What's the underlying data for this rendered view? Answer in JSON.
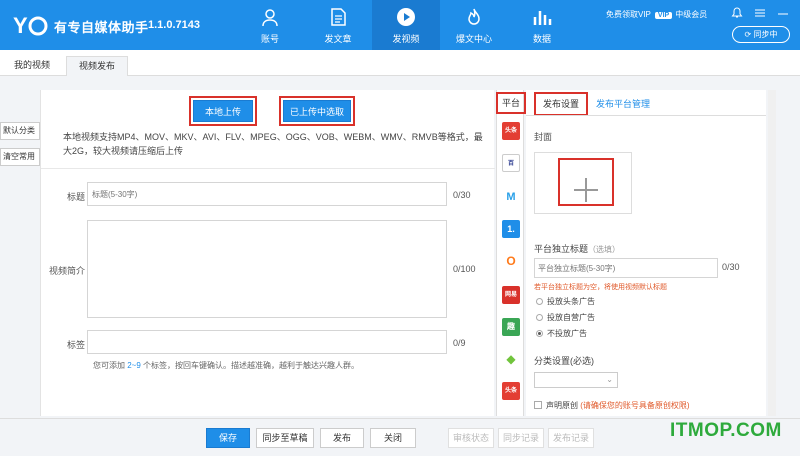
{
  "app": {
    "title": "有专自媒体助手",
    "version": "1.1.0.7143",
    "logo_text": "YC"
  },
  "nav": [
    {
      "label": "账号",
      "icon": "user-icon"
    },
    {
      "label": "发文章",
      "icon": "document-icon"
    },
    {
      "label": "发视频",
      "icon": "play-icon",
      "active": true
    },
    {
      "label": "爆文中心",
      "icon": "flame-icon"
    },
    {
      "label": "数据",
      "icon": "bar-chart-icon"
    }
  ],
  "header": {
    "vip_text": "免费领取VIP",
    "vip_badge": "VIP",
    "member_level": "中级会员",
    "sync_label": "同步中"
  },
  "tabs": {
    "my_videos": "我的视频",
    "video_publish": "视频发布"
  },
  "side": {
    "default_category": "默认分类",
    "clear_common": "清空常用"
  },
  "upload": {
    "local_upload": "本地上传",
    "choose_uploaded": "已上传中选取",
    "description": "本地视频支持MP4、MOV、MKV、AVI、FLV、MPEG、OGG、VOB、WEBM、WMV、RMVB等格式，最大2G，较大视频请压缩后上传"
  },
  "form": {
    "title_label": "标题",
    "title_placeholder": "标题(5-30字)",
    "title_count": "0/30",
    "intro_label": "视频简介",
    "intro_count": "0/100",
    "tags_label": "标签",
    "tags_count": "0/9",
    "tags_hint_prefix": "您可添加 ",
    "tags_hint_range": "2~9",
    "tags_hint_suffix": " 个标签，按回车键确认。描述越准确，越利于触达兴趣人群。"
  },
  "platforms": {
    "header": "平台",
    "items": [
      {
        "name": "toutiao-icon",
        "text": "头条",
        "color": "#e33e33"
      },
      {
        "name": "baijia-icon",
        "text": "百",
        "color": "#2b3b8f"
      },
      {
        "name": "dayu-icon",
        "text": "M",
        "color": "#ffffff"
      },
      {
        "name": "yidian-icon",
        "text": "1.",
        "color": "#1f8ee8"
      },
      {
        "name": "sohu-icon",
        "text": "O",
        "color": "#ff7a1a"
      },
      {
        "name": "wangyi-icon",
        "text": "网易",
        "color": "#d9312a"
      },
      {
        "name": "qutoutiao-icon",
        "text": "趣",
        "color": "#3aa655"
      },
      {
        "name": "aiqiyi-icon",
        "text": "◆",
        "color": "#71c43c"
      },
      {
        "name": "toutiao2-icon",
        "text": "头条",
        "color": "#e33e33"
      }
    ]
  },
  "settings": {
    "tab_settings": "发布设置",
    "tab_manage": "发布平台管理",
    "cover_label": "封面",
    "platform_title_label": "平台独立标题",
    "platform_title_optional": "（选填）",
    "platform_title_placeholder": "平台独立标题(5-30字)",
    "platform_title_count": "0/30",
    "platform_title_warn": "若平台独立标题为空，将使用视频默认标题",
    "ad_options": [
      "投放头条广告",
      "投放自营广告",
      "不投放广告"
    ],
    "ad_selected": 2,
    "category_label": "分类设置(必选)",
    "original_label": "声明原创",
    "original_warn": "(请确保您的账号具备原创权限)"
  },
  "bottom": {
    "save": "保存",
    "sync_draft": "同步至草稿",
    "publish": "发布",
    "close": "关闭",
    "review_status": "审核状态",
    "sync_record": "同步记录",
    "publish_record": "发布记录"
  },
  "watermark": "ITMOP.COM",
  "colors": {
    "brand": "#1f8ee8",
    "highlight": "#d9312a",
    "warn": "#e0592a"
  }
}
